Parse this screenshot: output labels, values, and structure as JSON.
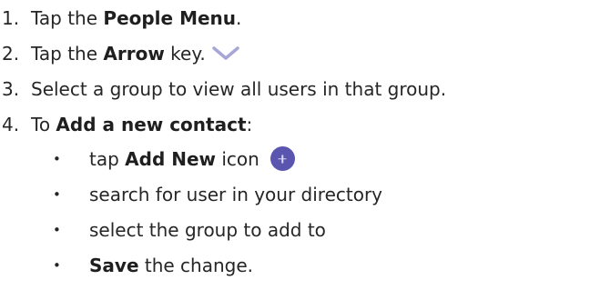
{
  "steps": [
    {
      "number": "1.",
      "pre": "Tap the ",
      "bold": "People Menu",
      "post": "."
    },
    {
      "number": "2.",
      "pre": "Tap the ",
      "bold": "Arrow",
      "post": " key."
    },
    {
      "number": "3.",
      "text": "Select a group to view all users in that group."
    },
    {
      "number": "4.",
      "pre": "To ",
      "bold": "Add a new contact",
      "post": ":"
    }
  ],
  "bullets": [
    {
      "symbol": "•",
      "pre": "tap ",
      "bold": "Add New",
      "post": " icon"
    },
    {
      "symbol": "•",
      "text": "search for user in your directory"
    },
    {
      "symbol": "•",
      "text": "select the group to add to"
    },
    {
      "symbol": "•",
      "bold": "Save",
      "post": " the change."
    }
  ],
  "icons": {
    "arrow": "chevron-down-icon",
    "add_new": "plus-circle-icon",
    "accent_color": "#5a56b0"
  }
}
